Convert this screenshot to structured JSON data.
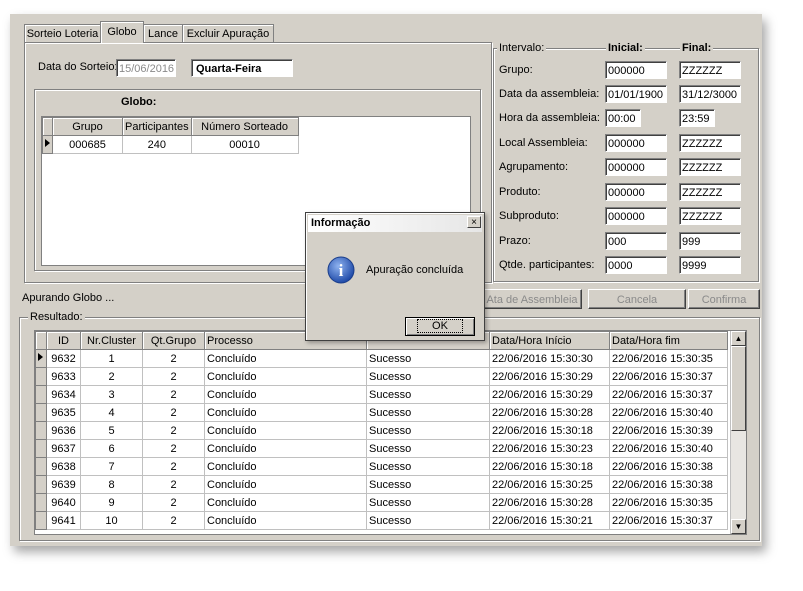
{
  "tabs": [
    {
      "label": "Sorteio Loteria"
    },
    {
      "label": "Globo"
    },
    {
      "label": "Lance"
    },
    {
      "label": "Excluir Apuração"
    }
  ],
  "draw": {
    "date_label": "Data do Sorteio:",
    "date_value": "15/06/2016",
    "weekday": "Quarta-Feira"
  },
  "globo": {
    "title": "Globo:",
    "headers": [
      "Grupo",
      "Participantes",
      "Número Sorteado"
    ],
    "rows": [
      [
        "000685",
        "240",
        "00010"
      ]
    ]
  },
  "intervalo": {
    "label": "Intervalo:",
    "inicial_label": "Inicial:",
    "final_label": "Final:",
    "rows": [
      {
        "label": "Grupo:",
        "inicial": "000000",
        "final": "ZZZZZZ"
      },
      {
        "label": "Data da assembleia:",
        "inicial": "01/01/1900",
        "final": "31/12/3000"
      },
      {
        "label": "Hora da assembleia:",
        "inicial": "00:00",
        "final": "23:59"
      },
      {
        "label": "Local Assembleia:",
        "inicial": "000000",
        "final": "ZZZZZZ"
      },
      {
        "label": "Agrupamento:",
        "inicial": "000000",
        "final": "ZZZZZZ"
      },
      {
        "label": "Produto:",
        "inicial": "000000",
        "final": "ZZZZZZ"
      },
      {
        "label": "Subproduto:",
        "inicial": "000000",
        "final": "ZZZZZZ"
      },
      {
        "label": "Prazo:",
        "inicial": "000",
        "final": "999"
      },
      {
        "label": "Qtde. participantes:",
        "inicial": "0000",
        "final": "9999"
      }
    ]
  },
  "status_text": "Apurando Globo ...",
  "buttons": {
    "ata": "Ata de Assembleia",
    "cancela": "Cancela",
    "confirma": "Confirma"
  },
  "resultado": {
    "label": "Resultado:",
    "headers": [
      "ID",
      "Nr.Cluster",
      "Qt.Grupo",
      "Processo",
      "",
      "Data/Hora Início",
      "Data/Hora fim"
    ],
    "rows": [
      [
        "9632",
        "1",
        "2",
        "Concluído",
        "Sucesso",
        "22/06/2016 15:30:30",
        "22/06/2016 15:30:35"
      ],
      [
        "9633",
        "2",
        "2",
        "Concluído",
        "Sucesso",
        "22/06/2016 15:30:29",
        "22/06/2016 15:30:37"
      ],
      [
        "9634",
        "3",
        "2",
        "Concluído",
        "Sucesso",
        "22/06/2016 15:30:29",
        "22/06/2016 15:30:37"
      ],
      [
        "9635",
        "4",
        "2",
        "Concluído",
        "Sucesso",
        "22/06/2016 15:30:28",
        "22/06/2016 15:30:40"
      ],
      [
        "9636",
        "5",
        "2",
        "Concluído",
        "Sucesso",
        "22/06/2016 15:30:18",
        "22/06/2016 15:30:39"
      ],
      [
        "9637",
        "6",
        "2",
        "Concluído",
        "Sucesso",
        "22/06/2016 15:30:23",
        "22/06/2016 15:30:40"
      ],
      [
        "9638",
        "7",
        "2",
        "Concluído",
        "Sucesso",
        "22/06/2016 15:30:18",
        "22/06/2016 15:30:38"
      ],
      [
        "9639",
        "8",
        "2",
        "Concluído",
        "Sucesso",
        "22/06/2016 15:30:25",
        "22/06/2016 15:30:38"
      ],
      [
        "9640",
        "9",
        "2",
        "Concluído",
        "Sucesso",
        "22/06/2016 15:30:28",
        "22/06/2016 15:30:35"
      ],
      [
        "9641",
        "10",
        "2",
        "Concluído",
        "Sucesso",
        "22/06/2016 15:30:21",
        "22/06/2016 15:30:37"
      ]
    ]
  },
  "dialog": {
    "title": "Informação",
    "close": "×",
    "message": "Apuração concluída",
    "icon_glyph": "i",
    "ok": "OK"
  },
  "colors": {
    "window_bg": "#d4d0c8",
    "info_icon": "#2f5fb8"
  }
}
